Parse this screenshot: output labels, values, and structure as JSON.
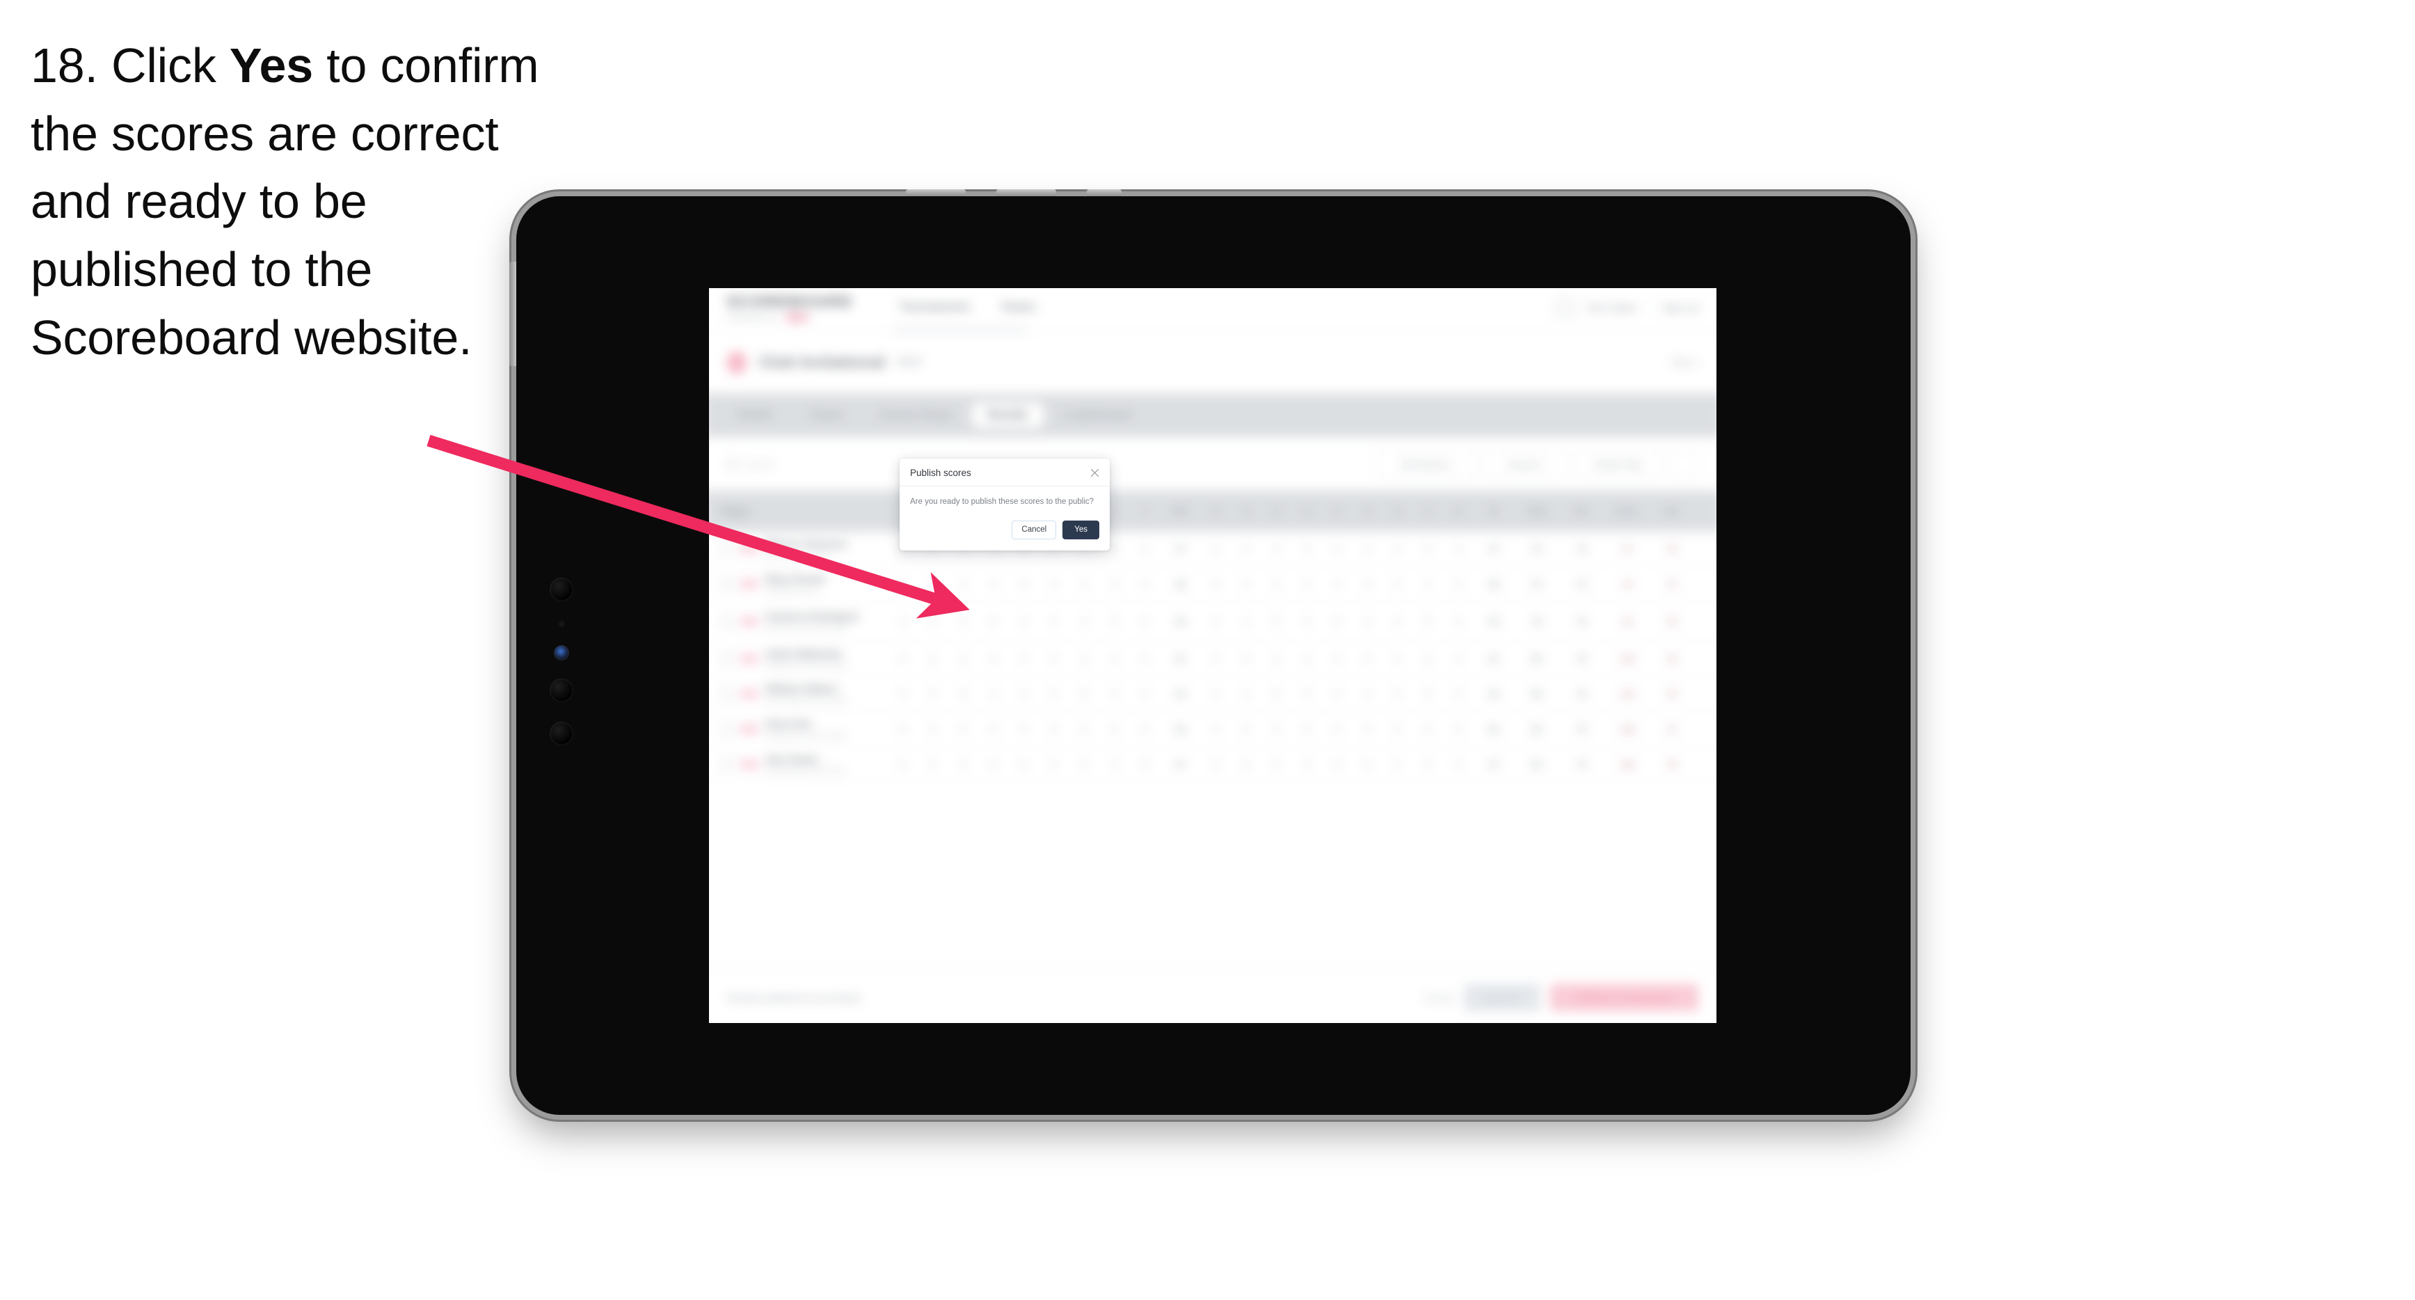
{
  "instruction": {
    "number": "18.",
    "lead": "Click",
    "emphasis": "Yes",
    "rest": "to confirm the scores are correct and ready to be published to the Scoreboard website."
  },
  "colors": {
    "arrow": "#ee2a5e",
    "accent_pink": "#e0305e",
    "primary_dark": "#2c3a4f",
    "device_body": "#0a0a0a",
    "device_bezel": "#9c9c9c"
  },
  "device": {
    "type": "tablet"
  },
  "app": {
    "header": {
      "brand": "SCOREBOARD",
      "brand_sub": "POWERED BY",
      "brand_pill": "BETA",
      "nav": [
        "Tournaments",
        "Teams"
      ],
      "user": "Tom Clarke",
      "signout": "Sign out"
    },
    "event": {
      "title": "Club Invitational",
      "tag": "2024",
      "right": "Day 2"
    },
    "tabs": [
      {
        "label": "Details",
        "active": false
      },
      {
        "label": "Teams",
        "active": false
      },
      {
        "label": "Course Setup",
        "active": false
      },
      {
        "label": "Results",
        "active": true
      },
      {
        "label": "Leaderboard",
        "active": false
      }
    ],
    "toolbar": {
      "search_placeholder": "Search",
      "filters": [
        "All Divisions",
        "Round 1",
        "Stroke Play"
      ],
      "icon_button": "settings-icon"
    },
    "table": {
      "player_header": "Player",
      "holes": [
        "1",
        "2",
        "3",
        "4",
        "5",
        "6",
        "7",
        "8",
        "9",
        "OUT",
        "10",
        "11",
        "12",
        "13",
        "14",
        "15",
        "16",
        "17",
        "18",
        "IN"
      ],
      "summary_headers": [
        "Total",
        "Par",
        "Score",
        "Net"
      ],
      "rows": [
        {
          "name": "Marcus Thomson",
          "sub": "Fairview Golf Club",
          "scores": [
            "4",
            "5",
            "3",
            "4",
            "5",
            "4",
            "3",
            "5",
            "4",
            "37",
            "4",
            "5",
            "4",
            "3",
            "5",
            "4",
            "4",
            "5",
            "3",
            "37"
          ],
          "total": "74",
          "par": "72",
          "score": "+2",
          "net": "70"
        },
        {
          "name": "Riley Parnell",
          "sub": "Oakmont Links",
          "scores": [
            "5",
            "4",
            "4",
            "4",
            "5",
            "4",
            "4",
            "4",
            "4",
            "38",
            "5",
            "4",
            "4",
            "4",
            "4",
            "5",
            "4",
            "4",
            "4",
            "38"
          ],
          "total": "76",
          "par": "72",
          "score": "+4",
          "net": "71"
        },
        {
          "name": "Cameron Rodriguez",
          "sub": "Pinehurst Country Club",
          "scores": [
            "4",
            "5",
            "4",
            "5",
            "4",
            "4",
            "4",
            "5",
            "4",
            "39",
            "4",
            "4",
            "5",
            "4",
            "5",
            "4",
            "4",
            "5",
            "4",
            "39"
          ],
          "total": "78",
          "par": "72",
          "score": "+6",
          "net": "72"
        },
        {
          "name": "Jamie Wakeman",
          "sub": "Westbrook Golf Society",
          "scores": [
            "5",
            "5",
            "4",
            "4",
            "5",
            "5",
            "4",
            "4",
            "5",
            "41",
            "5",
            "5",
            "4",
            "5",
            "4",
            "5",
            "4",
            "5",
            "4",
            "41"
          ],
          "total": "82",
          "par": "72",
          "score": "+10",
          "net": "74"
        },
        {
          "name": "William Hibbert",
          "sub": "Carnoustie Golf Society",
          "scores": [
            "5",
            "5",
            "5",
            "4",
            "5",
            "5",
            "5",
            "4",
            "5",
            "43",
            "5",
            "4",
            "5",
            "5",
            "5",
            "4",
            "5",
            "5",
            "5",
            "43"
          ],
          "total": "86",
          "par": "72",
          "score": "+14",
          "net": "75"
        },
        {
          "name": "Sean Kirk",
          "sub": "Rosewood Golf Society",
          "scores": [
            "5",
            "5",
            "5",
            "5",
            "5",
            "5",
            "5",
            "5",
            "5",
            "45",
            "5",
            "5",
            "5",
            "5",
            "5",
            "5",
            "5",
            "5",
            "5",
            "45"
          ],
          "total": "90",
          "par": "72",
          "score": "+18",
          "net": "77"
        },
        {
          "name": "Alex Dukes",
          "sub": "Ravenswood Golf Club",
          "scores": [
            "6",
            "5",
            "5",
            "5",
            "6",
            "5",
            "5",
            "5",
            "5",
            "47",
            "5",
            "6",
            "5",
            "5",
            "5",
            "6",
            "5",
            "5",
            "5",
            "47"
          ],
          "total": "94",
          "par": "72",
          "score": "+22",
          "net": "79"
        }
      ]
    },
    "footer": {
      "note": "Results published successfully",
      "link": "Cancel",
      "secondary_button": "Save all",
      "primary_button": "Publish to Scoreboard"
    }
  },
  "modal": {
    "title": "Publish scores",
    "message": "Are you ready to publish these scores to the public?",
    "cancel_label": "Cancel",
    "confirm_label": "Yes",
    "close_icon": "close-icon"
  }
}
